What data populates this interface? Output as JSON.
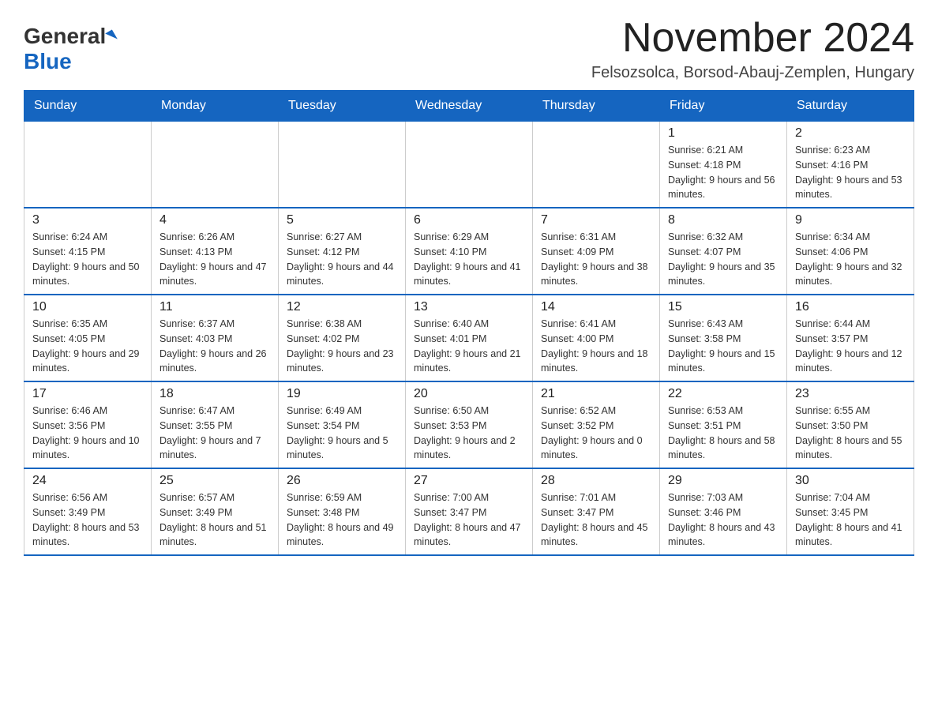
{
  "header": {
    "logo_general": "General",
    "logo_blue": "Blue",
    "month_title": "November 2024",
    "subtitle": "Felsozsolca, Borsod-Abauj-Zemplen, Hungary"
  },
  "days_of_week": [
    "Sunday",
    "Monday",
    "Tuesday",
    "Wednesday",
    "Thursday",
    "Friday",
    "Saturday"
  ],
  "weeks": [
    {
      "days": [
        {
          "number": "",
          "info": ""
        },
        {
          "number": "",
          "info": ""
        },
        {
          "number": "",
          "info": ""
        },
        {
          "number": "",
          "info": ""
        },
        {
          "number": "",
          "info": ""
        },
        {
          "number": "1",
          "info": "Sunrise: 6:21 AM\nSunset: 4:18 PM\nDaylight: 9 hours and 56 minutes."
        },
        {
          "number": "2",
          "info": "Sunrise: 6:23 AM\nSunset: 4:16 PM\nDaylight: 9 hours and 53 minutes."
        }
      ]
    },
    {
      "days": [
        {
          "number": "3",
          "info": "Sunrise: 6:24 AM\nSunset: 4:15 PM\nDaylight: 9 hours and 50 minutes."
        },
        {
          "number": "4",
          "info": "Sunrise: 6:26 AM\nSunset: 4:13 PM\nDaylight: 9 hours and 47 minutes."
        },
        {
          "number": "5",
          "info": "Sunrise: 6:27 AM\nSunset: 4:12 PM\nDaylight: 9 hours and 44 minutes."
        },
        {
          "number": "6",
          "info": "Sunrise: 6:29 AM\nSunset: 4:10 PM\nDaylight: 9 hours and 41 minutes."
        },
        {
          "number": "7",
          "info": "Sunrise: 6:31 AM\nSunset: 4:09 PM\nDaylight: 9 hours and 38 minutes."
        },
        {
          "number": "8",
          "info": "Sunrise: 6:32 AM\nSunset: 4:07 PM\nDaylight: 9 hours and 35 minutes."
        },
        {
          "number": "9",
          "info": "Sunrise: 6:34 AM\nSunset: 4:06 PM\nDaylight: 9 hours and 32 minutes."
        }
      ]
    },
    {
      "days": [
        {
          "number": "10",
          "info": "Sunrise: 6:35 AM\nSunset: 4:05 PM\nDaylight: 9 hours and 29 minutes."
        },
        {
          "number": "11",
          "info": "Sunrise: 6:37 AM\nSunset: 4:03 PM\nDaylight: 9 hours and 26 minutes."
        },
        {
          "number": "12",
          "info": "Sunrise: 6:38 AM\nSunset: 4:02 PM\nDaylight: 9 hours and 23 minutes."
        },
        {
          "number": "13",
          "info": "Sunrise: 6:40 AM\nSunset: 4:01 PM\nDaylight: 9 hours and 21 minutes."
        },
        {
          "number": "14",
          "info": "Sunrise: 6:41 AM\nSunset: 4:00 PM\nDaylight: 9 hours and 18 minutes."
        },
        {
          "number": "15",
          "info": "Sunrise: 6:43 AM\nSunset: 3:58 PM\nDaylight: 9 hours and 15 minutes."
        },
        {
          "number": "16",
          "info": "Sunrise: 6:44 AM\nSunset: 3:57 PM\nDaylight: 9 hours and 12 minutes."
        }
      ]
    },
    {
      "days": [
        {
          "number": "17",
          "info": "Sunrise: 6:46 AM\nSunset: 3:56 PM\nDaylight: 9 hours and 10 minutes."
        },
        {
          "number": "18",
          "info": "Sunrise: 6:47 AM\nSunset: 3:55 PM\nDaylight: 9 hours and 7 minutes."
        },
        {
          "number": "19",
          "info": "Sunrise: 6:49 AM\nSunset: 3:54 PM\nDaylight: 9 hours and 5 minutes."
        },
        {
          "number": "20",
          "info": "Sunrise: 6:50 AM\nSunset: 3:53 PM\nDaylight: 9 hours and 2 minutes."
        },
        {
          "number": "21",
          "info": "Sunrise: 6:52 AM\nSunset: 3:52 PM\nDaylight: 9 hours and 0 minutes."
        },
        {
          "number": "22",
          "info": "Sunrise: 6:53 AM\nSunset: 3:51 PM\nDaylight: 8 hours and 58 minutes."
        },
        {
          "number": "23",
          "info": "Sunrise: 6:55 AM\nSunset: 3:50 PM\nDaylight: 8 hours and 55 minutes."
        }
      ]
    },
    {
      "days": [
        {
          "number": "24",
          "info": "Sunrise: 6:56 AM\nSunset: 3:49 PM\nDaylight: 8 hours and 53 minutes."
        },
        {
          "number": "25",
          "info": "Sunrise: 6:57 AM\nSunset: 3:49 PM\nDaylight: 8 hours and 51 minutes."
        },
        {
          "number": "26",
          "info": "Sunrise: 6:59 AM\nSunset: 3:48 PM\nDaylight: 8 hours and 49 minutes."
        },
        {
          "number": "27",
          "info": "Sunrise: 7:00 AM\nSunset: 3:47 PM\nDaylight: 8 hours and 47 minutes."
        },
        {
          "number": "28",
          "info": "Sunrise: 7:01 AM\nSunset: 3:47 PM\nDaylight: 8 hours and 45 minutes."
        },
        {
          "number": "29",
          "info": "Sunrise: 7:03 AM\nSunset: 3:46 PM\nDaylight: 8 hours and 43 minutes."
        },
        {
          "number": "30",
          "info": "Sunrise: 7:04 AM\nSunset: 3:45 PM\nDaylight: 8 hours and 41 minutes."
        }
      ]
    }
  ]
}
